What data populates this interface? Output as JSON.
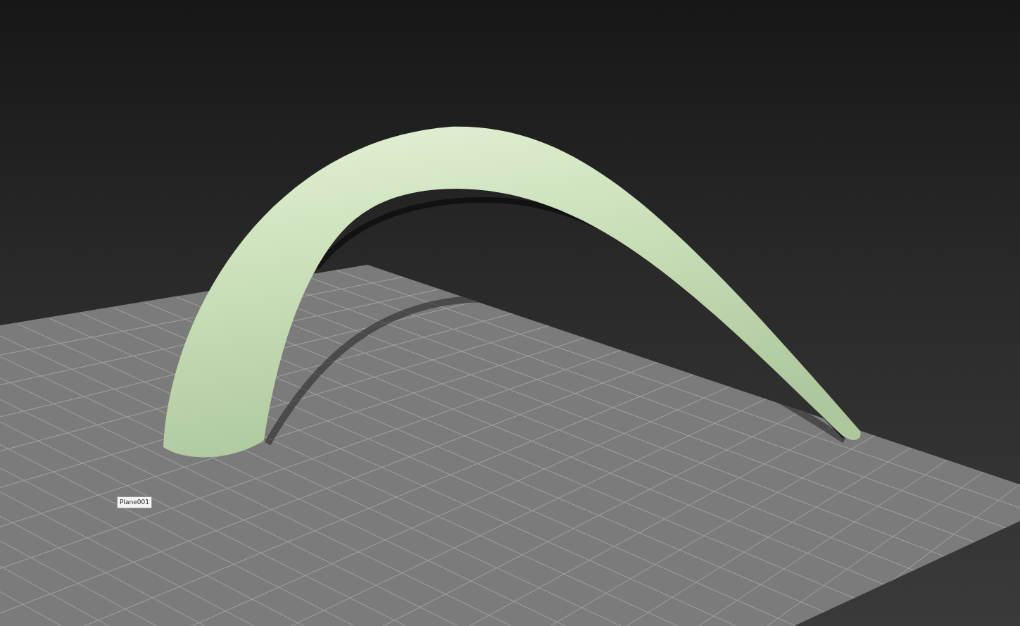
{
  "viewport": {
    "object_label": "Plane001"
  }
}
